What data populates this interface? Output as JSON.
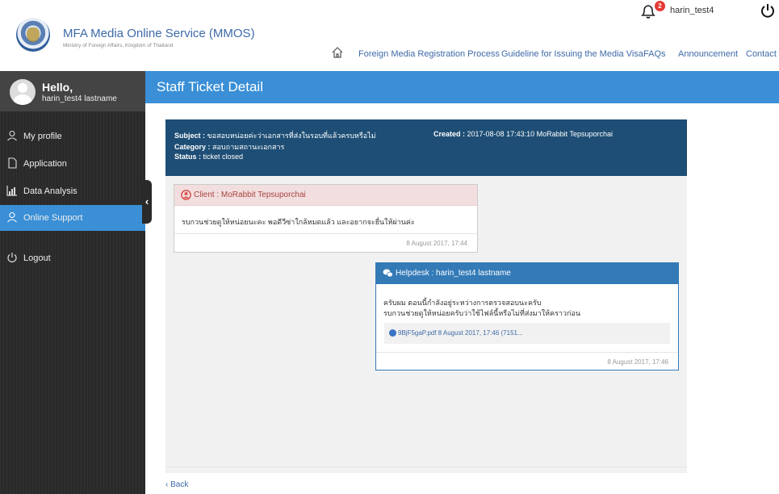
{
  "header": {
    "brand_title": "MFA Media Online Service (MMOS)",
    "brand_subtitle": "Ministry of Foreign Affairs, Kingdom of Thailand",
    "notification_count": "2",
    "username": "harin_test4",
    "nav": [
      {
        "label": "Foreign Media Registration Process"
      },
      {
        "label": "Guideline for Issuing the Media Visa"
      },
      {
        "label": "FAQs"
      },
      {
        "label": "Announcement"
      },
      {
        "label": "Contact"
      }
    ]
  },
  "sidebar": {
    "greeting": "Hello,",
    "user_fullname": "harin_test4 lastname",
    "items": [
      {
        "label": "My profile",
        "icon": "user-icon"
      },
      {
        "label": "Application",
        "icon": "document-icon"
      },
      {
        "label": "Data Analysis",
        "icon": "bar-chart-icon"
      },
      {
        "label": "Online Support",
        "icon": "support-icon"
      },
      {
        "label": "Logout",
        "icon": "power-icon"
      }
    ],
    "active_item": "Online Support"
  },
  "page": {
    "title": "Staff Ticket Detail",
    "back_label": "‹ Back"
  },
  "ticket": {
    "subject_label": "Subject :",
    "subject_value": "ขอสอบหน่อยค่ะว่าเอกสารที่ส่งในรอบที่แล้วครบหรือไม่",
    "category_label": "Category :",
    "category_value": "สอบถามสถานะเอกสาร",
    "status_label": "Status :",
    "status_value": "ticket closed",
    "created_label": "Created :",
    "created_value": "2017-08-08 17:43:10 MoRabbit Tepsuporchai"
  },
  "messages": {
    "client": {
      "header": "Client : MoRabbit Tepsuporchai",
      "body": "รบกวนช่วยดูให้หน่อยนะคะ พอดีวีซ่าใกล้หมดแล้ว และอยากจะยื่นให้ผ่านค่ะ",
      "timestamp": "8 August 2017, 17:44"
    },
    "helpdesk": {
      "header": "Helpdesk : harin_test4 lastname",
      "body_line1": "ครับผม ตอนนี้กำลังอยู่ระหว่างการตรวจสอบนะครับ",
      "body_line2": "รบกวนช่วยดูให้หน่อยครับว่าใช้ไฟล์นี้หรือไม่ที่ส่งมาให้คราวก่อน",
      "attachment": "9BjF5gaP.pdf 8 August 2017, 17:46 (7151...",
      "timestamp": "8 August 2017, 17:46"
    }
  },
  "colors": {
    "accent": "#3a8fd6",
    "ticket_header": "#1e4e75",
    "client_header_bg": "#f2dede",
    "client_header_text": "#a94442",
    "helpdesk_header": "#337ab7",
    "sidebar_bg": "#2a2a2a"
  }
}
